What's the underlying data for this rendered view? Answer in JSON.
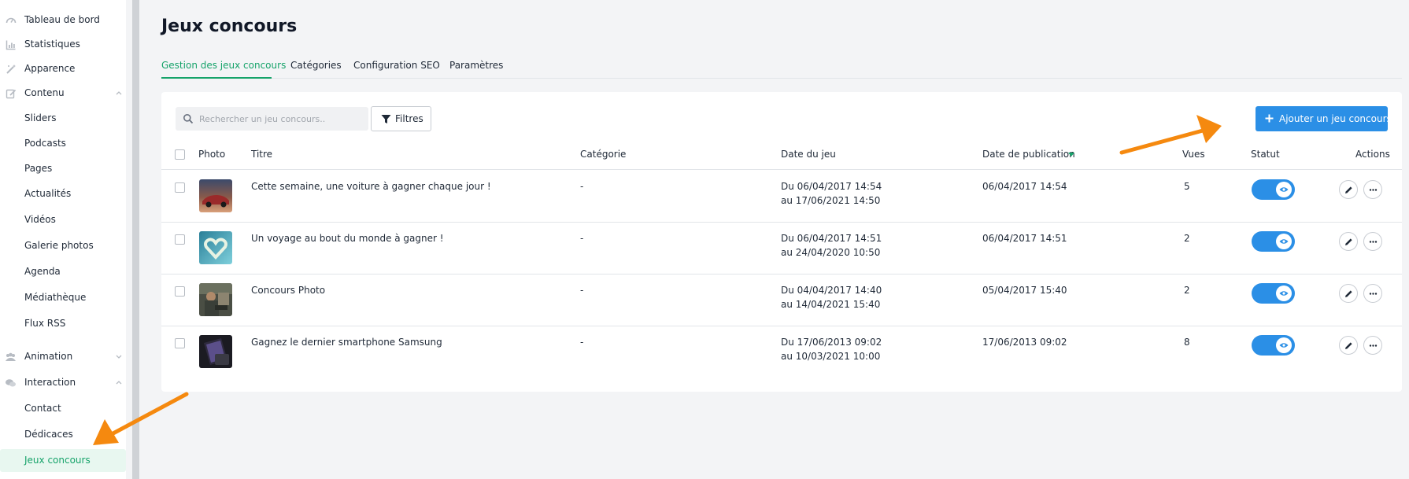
{
  "sidebar": {
    "items": [
      {
        "label": "Tableau de bord",
        "icon": "dashboard-icon"
      },
      {
        "label": "Statistiques",
        "icon": "chart-icon"
      },
      {
        "label": "Apparence",
        "icon": "magic-wand-icon"
      },
      {
        "label": "Contenu",
        "icon": "edit-icon",
        "expanded": true
      },
      {
        "label": "Sliders"
      },
      {
        "label": "Podcasts"
      },
      {
        "label": "Pages"
      },
      {
        "label": "Actualités"
      },
      {
        "label": "Vidéos"
      },
      {
        "label": "Galerie photos"
      },
      {
        "label": "Agenda"
      },
      {
        "label": "Médiathèque"
      },
      {
        "label": "Flux RSS"
      },
      {
        "label": "Animation",
        "icon": "users-icon",
        "expanded": false
      },
      {
        "label": "Interaction",
        "icon": "chat-icon",
        "expanded": true
      },
      {
        "label": "Contact"
      },
      {
        "label": "Dédicaces"
      },
      {
        "label": "Jeux concours",
        "active": true
      }
    ]
  },
  "page": {
    "title": "Jeux concours"
  },
  "tabs": [
    {
      "label": "Gestion des jeux concours",
      "active": true
    },
    {
      "label": "Catégories"
    },
    {
      "label": "Configuration SEO"
    },
    {
      "label": "Paramètres"
    }
  ],
  "toolbar": {
    "search_placeholder": "Rechercher un jeu concours..",
    "filter_label": "Filtres",
    "add_label": "Ajouter un jeu concours"
  },
  "table": {
    "headers": {
      "photo": "Photo",
      "title": "Titre",
      "category": "Catégorie",
      "game_date": "Date du jeu",
      "pub_date": "Date de publication",
      "views": "Vues",
      "status": "Statut",
      "actions": "Actions"
    },
    "rows": [
      {
        "title": "Cette semaine, une voiture à gagner chaque jour !",
        "category": "-",
        "date_from": "Du 06/04/2017 14:54",
        "date_to": "au 17/06/2021 14:50",
        "pub_date": "06/04/2017 14:54",
        "views": "5",
        "active": true
      },
      {
        "title": "Un voyage au bout du monde à gagner !",
        "category": "-",
        "date_from": "Du 06/04/2017 14:51",
        "date_to": "au 24/04/2020 10:50",
        "pub_date": "06/04/2017 14:51",
        "views": "2",
        "active": true
      },
      {
        "title": "Concours Photo",
        "category": "-",
        "date_from": "Du 04/04/2017 14:40",
        "date_to": "au 14/04/2021 15:40",
        "pub_date": "05/04/2017 15:40",
        "views": "2",
        "active": true
      },
      {
        "title": "Gagnez le dernier smartphone Samsung",
        "category": "-",
        "date_from": "Du 17/06/2013 09:02",
        "date_to": "au 10/03/2021 10:00",
        "pub_date": "17/06/2013 09:02",
        "views": "8",
        "active": true
      }
    ]
  },
  "colors": {
    "accent": "#16a36a",
    "primary": "#2b8fe6",
    "annotation_arrow": "#f5890f"
  }
}
